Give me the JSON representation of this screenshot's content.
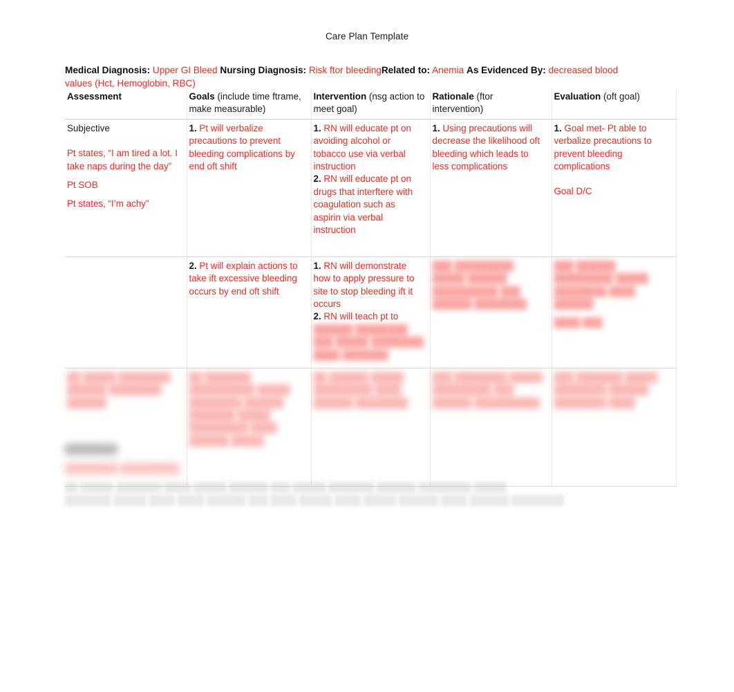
{
  "document": {
    "title": "Care Plan Template"
  },
  "diagnosis": {
    "medical_label": "Medical Diagnosis:",
    "medical_value": "Upper GI Bleed",
    "nursing_label": "Nursing Diagnosis:",
    "nursing_value": "Risk ftor bleeding",
    "related_label": "Related to:",
    "related_value": "Anemia",
    "evidence_label": "As Evidenced By:",
    "evidence_value": "decreased blood values (Hct, Hemoglobin, RBC)"
  },
  "table": {
    "headers": [
      {
        "main": "Assessment",
        "sub": ""
      },
      {
        "main": "Goals",
        "sub": "(include time ftrame, make measurable)"
      },
      {
        "main": "Intervention",
        "sub": "(nsg action to meet goal)"
      },
      {
        "main": "Rationale",
        "sub": "(ftor intervention)"
      },
      {
        "main": "Evaluation",
        "sub": "(oft goal)"
      }
    ],
    "row1": {
      "assessment": {
        "heading": "Subjective",
        "lines": [
          "Pt states, “I am tired a lot. I take naps during the day”",
          "Pt SOB",
          "Pt states, “I’m achy”"
        ]
      },
      "goals": [
        {
          "num": "1.",
          "text": "Pt will verbalize precautions to prevent bleeding complications by end oft shift"
        }
      ],
      "intervention": [
        {
          "num": "1.",
          "text": "RN will educate pt on avoiding alcohol or tobacco use via verbal instruction"
        },
        {
          "num": "2.",
          "text": "RN will educate pt on drugs that interftere with coagulation such as aspirin via verbal instruction"
        }
      ],
      "rationale": [
        {
          "num": "1.",
          "text": "Using precautions will decrease the likelihood oft bleeding which leads to less complications"
        }
      ],
      "evaluation": [
        {
          "num": "1.",
          "text": "Goal met- Pt able to verbalize precautions to prevent bleeding complications"
        }
      ],
      "evaluation_note": "Goal D/C"
    },
    "row2": {
      "assessment": "",
      "goals": [
        {
          "num": "2.",
          "text": "Pt will explain actions to take ift excessive bleeding occurs by end oft shift"
        }
      ],
      "intervention": [
        {
          "num": "1.",
          "text": "RN will demonstrate how to apply pressure to site to stop bleeding ift it occurs"
        },
        {
          "num": "2.",
          "text": "RN will teach pt to"
        }
      ],
      "intervention_obscured": "██████ ████████ ███ █████ ████████ ████ ███████",
      "rationale_obscured": "███ █████████ █████ ██████ ██████████ ███ ██████ ████████",
      "evaluation_obscured": "███ ██████ █████████ █████ ████████ ████ ██████",
      "evaluation_note_obscured": "████ ███"
    },
    "row3": {
      "assessment_obscured": "██ █████ ████████ ██████ ████████ ██████",
      "goals_obscured": "██ ███████ ██████████ █████ ████████ ██████ ███████ █████ █████████ ████ ██████ █████",
      "intervention_obscured": "██ ██████ █████ █████████ ████ ██████ ████████",
      "rationale_obscured": "███ ████████ █████ █████████ ███ ██████ ██████████",
      "evaluation_obscured": "███ ███████ █████ ████████ ██████ ████████ ████"
    }
  },
  "bottom": {
    "objective_label_obscured": "████████",
    "red_line_obscured": "████████ █████████",
    "gray_line_1_obscured": "██ █████ ███████ ████ █████ ██████ ███ █████ ███████ ██████ ████████ █████",
    "gray_line_2_obscured": "███████ █████ ████ ████ ██████ ███ ████ █████ ████ █████ ██████ ████ ██████ ████████"
  },
  "colors": {
    "accent_red": "#ef2b22",
    "text_black": "#1a1a1a",
    "page_background": "#ffffff"
  }
}
